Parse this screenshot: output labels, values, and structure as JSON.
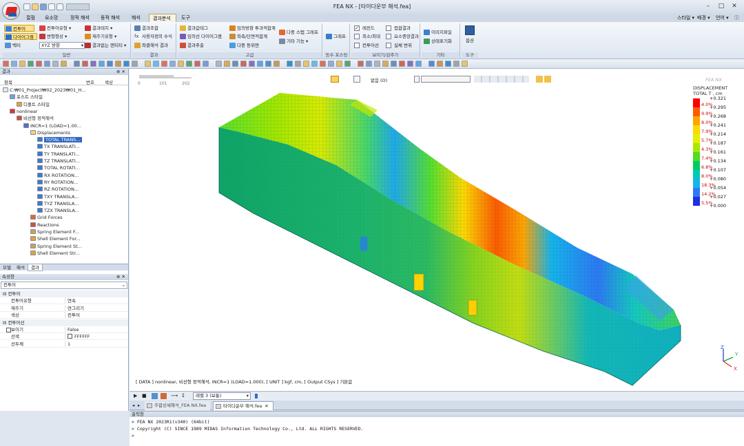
{
  "app": {
    "title": "FEA NX - [타이다운부 해석.fea]",
    "right_menu": [
      "스타일 ▾",
      "배경 ▾",
      "언어 ▾"
    ]
  },
  "menus": [
    "절점",
    "요소망",
    "정적 해석",
    "동적 해석",
    "해석",
    "결과분석",
    "도구"
  ],
  "active_menu": "결과분석",
  "ribbon": {
    "general": {
      "label": "일반",
      "items": [
        "컨투어",
        "다이어그램",
        "벡터",
        "컨투어유형 ▾",
        "변형형상 ▾",
        "XYZ 방향",
        "결과테지 ▾",
        "재주기유형 ▾",
        "결과없는 엔티티 ▾"
      ]
    },
    "result": {
      "label": "결과",
      "items": [
        "결과조합",
        "사용자정의 수식",
        "좌클해석 결과"
      ]
    },
    "advanced": {
      "label": "고급",
      "items": [
        "결과값테그",
        "임의선 다이어그램",
        "결과추출",
        "임의방향 투과적합계",
        "좌측/단면적합계",
        "다중 등위면",
        "다중 스텝 그래프",
        "기타 기능 ▾"
      ]
    },
    "graph": {
      "label": "동수 포스팅",
      "items": [
        "그래프"
      ]
    },
    "view": {
      "label": "보이기/감추기",
      "items": [
        "레전드",
        "최소/최대",
        "컨투어선",
        "접합결과",
        "요소중앙결과",
        "실체 변위"
      ]
    },
    "etc": {
      "label": "기타",
      "items": [
        "이미지파일",
        "상태표기화"
      ]
    },
    "tools": {
      "label": "도구",
      "items": [
        "옵션"
      ]
    }
  },
  "left": {
    "header": "결과",
    "columns": [
      "항목",
      "번호",
      "색상"
    ],
    "tree": [
      "C:₩01_Project₩02_2023₩01_H...",
      "포스트 스타일",
      "디폴트 스타일",
      "nonlinear",
      "비선형 정적해석",
      "INCR=1 (LOAD=1.00...",
      "Displacements",
      "TOTAL TRANS...",
      "TX TRANSLATI...",
      "TY TRANSLATI...",
      "TZ TRANSLATI...",
      "TOTAL ROTATI...",
      "RX ROTATION...",
      "RY ROTATION...",
      "RZ ROTATION...",
      "TXY TRANSLA...",
      "TYZ TRANSLA...",
      "TZX TRANSLA...",
      "Grid Forces",
      "Reactions",
      "Spring Element F...",
      "Shell Element For...",
      "Spring Element St...",
      "Shell Element Str..."
    ],
    "tabs": [
      "모델",
      "해석",
      "결과"
    ],
    "active_tab": "결과",
    "prop_header": "속성창",
    "prop_select": "컨투어",
    "prop_rows": [
      {
        "k": "컨투어",
        "v": "",
        "sec": true
      },
      {
        "k": "컨투어유형",
        "v": "연속"
      },
      {
        "k": "재주기",
        "v": "연그리기"
      },
      {
        "k": "색상",
        "v": "컨투어"
      },
      {
        "k": "컨투어선",
        "v": "",
        "sec": true
      },
      {
        "k": "보이기",
        "v": "False"
      },
      {
        "k": "선색",
        "v": "FFFFFF"
      },
      {
        "k": "선두께",
        "v": "1"
      }
    ]
  },
  "viewport": {
    "scale": [
      "0",
      "101",
      "202"
    ],
    "view_select": "없음 (O)",
    "watermark": "FEA NX",
    "legend_title": "DISPLACEMENT",
    "legend_sub": "TOTAL T , cm",
    "legend": [
      {
        "pct": "4.0%",
        "val": "+0.321",
        "color": "#ff0000"
      },
      {
        "pct": "9.9%",
        "val": "+0.295",
        "color": "#ff5a00"
      },
      {
        "pct": "8.0%",
        "val": "+0.268",
        "color": "#ffa500"
      },
      {
        "pct": "7.9%",
        "val": "+0.241",
        "color": "#ffd800"
      },
      {
        "pct": "5.7%",
        "val": "+0.214",
        "color": "#e3f000"
      },
      {
        "pct": "4.3%",
        "val": "+0.187",
        "color": "#a6e800"
      },
      {
        "pct": "7.4%",
        "val": "+0.161",
        "color": "#4fdc22"
      },
      {
        "pct": "6.8%",
        "val": "+0.134",
        "color": "#00cc66"
      },
      {
        "pct": "8.0%",
        "val": "+0.107",
        "color": "#00c9b6"
      },
      {
        "pct": "18.3%",
        "val": "+0.080",
        "color": "#14b4ec"
      },
      {
        "pct": "14.2%",
        "val": "+0.054",
        "color": "#2d78f4"
      },
      {
        "pct": "5.5%",
        "val": "+0.027",
        "color": "#1e2ee6"
      }
    ],
    "legend_min": "+0.000",
    "status": "[ DATA ] nonlinear, 비선형 정적해석, INCR=1 (LOAD=1.000), [ UNIT ] kgf, cm, [ Output CSys ] 기본값",
    "axes": [
      "Z",
      "Y",
      "X"
    ]
  },
  "anim": {
    "level": "레벨 3 (보통)"
  },
  "doc_tabs": [
    "주합상세해석_FEA NX.fea",
    "타이다운부 해석.fea"
  ],
  "active_doc": 1,
  "output": {
    "header": "출력창",
    "lines": [
      "> FEA NX 2023R1(v340) (64bit)",
      "> Copyright (C) SINCE 1989 MIDAS Information Technology Co., Ltd. ALL RIGHTS RESERVED.",
      ">"
    ]
  }
}
